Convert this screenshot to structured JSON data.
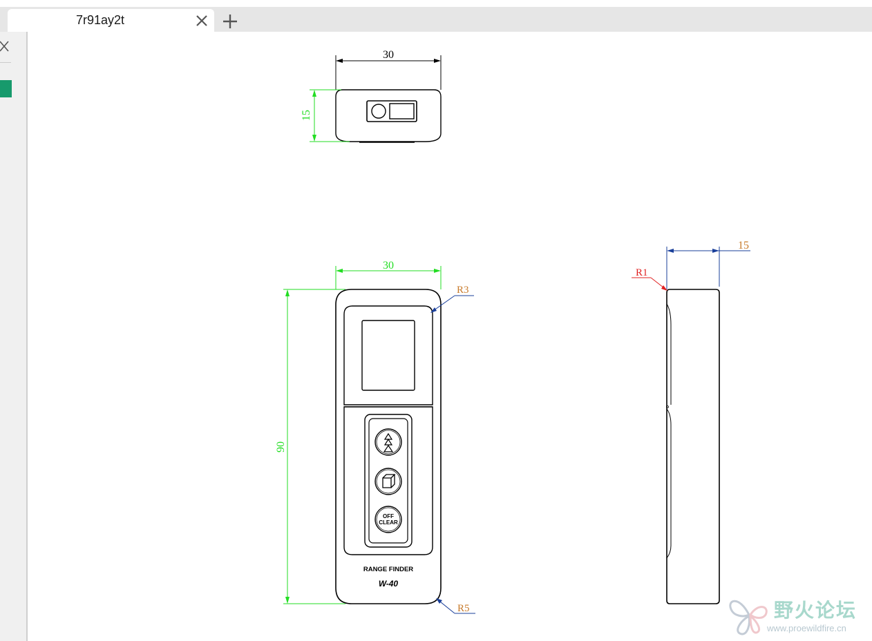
{
  "tab": {
    "title": "7r91ay2t",
    "close_icon": "close-icon",
    "new_tab_icon": "plus-icon"
  },
  "panel": {
    "close_icon": "close-icon"
  },
  "drawing": {
    "top_view": {
      "width_dim": "30",
      "height_dim": "15"
    },
    "front_view": {
      "width_dim": "30",
      "height_dim": "90",
      "corner_radius_top": "R3",
      "corner_radius_bottom": "R5",
      "brand": "RANGE FINDER",
      "model": "W-40",
      "button_clear_top": "OFF",
      "button_clear_bottom": "CLEAR"
    },
    "side_view": {
      "depth_dim": "15",
      "edge_radius": "R1"
    }
  },
  "watermark": {
    "title": "野火论坛",
    "url": "www.proewildfire.cn"
  },
  "colors": {
    "dim_green": "#22dd22",
    "dim_blue": "#1a3f9a",
    "dim_orange": "#c87a2a",
    "dim_red": "#e02020",
    "outline": "#000000"
  }
}
